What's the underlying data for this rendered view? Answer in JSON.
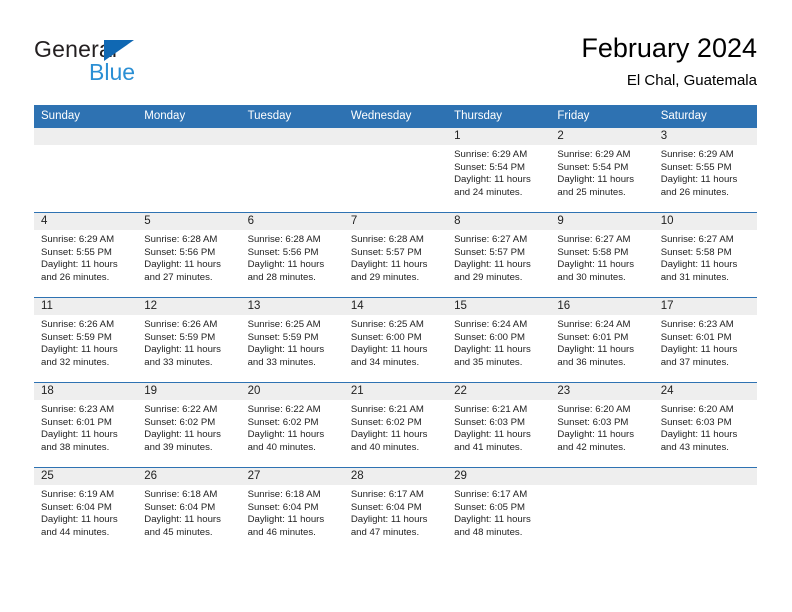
{
  "brand": {
    "name_part1": "General",
    "name_part2": "Blue",
    "triangle_icon": "blue-triangle-icon",
    "accent_blue": "#2e72b2",
    "logo_blue": "#2b8fd4"
  },
  "header": {
    "title": "February 2024",
    "subtitle": "El Chal, Guatemala"
  },
  "weekday_headers": [
    "Sunday",
    "Monday",
    "Tuesday",
    "Wednesday",
    "Thursday",
    "Friday",
    "Saturday"
  ],
  "labels": {
    "sunrise_prefix": "Sunrise:",
    "sunset_prefix": "Sunset:",
    "daylight_prefix": "Daylight:"
  },
  "weeks": [
    [
      {
        "day": "",
        "sunrise": "",
        "sunset": "",
        "daylight": "",
        "empty": true
      },
      {
        "day": "",
        "sunrise": "",
        "sunset": "",
        "daylight": "",
        "empty": true
      },
      {
        "day": "",
        "sunrise": "",
        "sunset": "",
        "daylight": "",
        "empty": true
      },
      {
        "day": "",
        "sunrise": "",
        "sunset": "",
        "daylight": "",
        "empty": true
      },
      {
        "day": "1",
        "sunrise": "Sunrise: 6:29 AM",
        "sunset": "Sunset: 5:54 PM",
        "daylight": "Daylight: 11 hours and 24 minutes.",
        "empty": false
      },
      {
        "day": "2",
        "sunrise": "Sunrise: 6:29 AM",
        "sunset": "Sunset: 5:54 PM",
        "daylight": "Daylight: 11 hours and 25 minutes.",
        "empty": false
      },
      {
        "day": "3",
        "sunrise": "Sunrise: 6:29 AM",
        "sunset": "Sunset: 5:55 PM",
        "daylight": "Daylight: 11 hours and 26 minutes.",
        "empty": false
      }
    ],
    [
      {
        "day": "4",
        "sunrise": "Sunrise: 6:29 AM",
        "sunset": "Sunset: 5:55 PM",
        "daylight": "Daylight: 11 hours and 26 minutes.",
        "empty": false
      },
      {
        "day": "5",
        "sunrise": "Sunrise: 6:28 AM",
        "sunset": "Sunset: 5:56 PM",
        "daylight": "Daylight: 11 hours and 27 minutes.",
        "empty": false
      },
      {
        "day": "6",
        "sunrise": "Sunrise: 6:28 AM",
        "sunset": "Sunset: 5:56 PM",
        "daylight": "Daylight: 11 hours and 28 minutes.",
        "empty": false
      },
      {
        "day": "7",
        "sunrise": "Sunrise: 6:28 AM",
        "sunset": "Sunset: 5:57 PM",
        "daylight": "Daylight: 11 hours and 29 minutes.",
        "empty": false
      },
      {
        "day": "8",
        "sunrise": "Sunrise: 6:27 AM",
        "sunset": "Sunset: 5:57 PM",
        "daylight": "Daylight: 11 hours and 29 minutes.",
        "empty": false
      },
      {
        "day": "9",
        "sunrise": "Sunrise: 6:27 AM",
        "sunset": "Sunset: 5:58 PM",
        "daylight": "Daylight: 11 hours and 30 minutes.",
        "empty": false
      },
      {
        "day": "10",
        "sunrise": "Sunrise: 6:27 AM",
        "sunset": "Sunset: 5:58 PM",
        "daylight": "Daylight: 11 hours and 31 minutes.",
        "empty": false
      }
    ],
    [
      {
        "day": "11",
        "sunrise": "Sunrise: 6:26 AM",
        "sunset": "Sunset: 5:59 PM",
        "daylight": "Daylight: 11 hours and 32 minutes.",
        "empty": false
      },
      {
        "day": "12",
        "sunrise": "Sunrise: 6:26 AM",
        "sunset": "Sunset: 5:59 PM",
        "daylight": "Daylight: 11 hours and 33 minutes.",
        "empty": false
      },
      {
        "day": "13",
        "sunrise": "Sunrise: 6:25 AM",
        "sunset": "Sunset: 5:59 PM",
        "daylight": "Daylight: 11 hours and 33 minutes.",
        "empty": false
      },
      {
        "day": "14",
        "sunrise": "Sunrise: 6:25 AM",
        "sunset": "Sunset: 6:00 PM",
        "daylight": "Daylight: 11 hours and 34 minutes.",
        "empty": false
      },
      {
        "day": "15",
        "sunrise": "Sunrise: 6:24 AM",
        "sunset": "Sunset: 6:00 PM",
        "daylight": "Daylight: 11 hours and 35 minutes.",
        "empty": false
      },
      {
        "day": "16",
        "sunrise": "Sunrise: 6:24 AM",
        "sunset": "Sunset: 6:01 PM",
        "daylight": "Daylight: 11 hours and 36 minutes.",
        "empty": false
      },
      {
        "day": "17",
        "sunrise": "Sunrise: 6:23 AM",
        "sunset": "Sunset: 6:01 PM",
        "daylight": "Daylight: 11 hours and 37 minutes.",
        "empty": false
      }
    ],
    [
      {
        "day": "18",
        "sunrise": "Sunrise: 6:23 AM",
        "sunset": "Sunset: 6:01 PM",
        "daylight": "Daylight: 11 hours and 38 minutes.",
        "empty": false
      },
      {
        "day": "19",
        "sunrise": "Sunrise: 6:22 AM",
        "sunset": "Sunset: 6:02 PM",
        "daylight": "Daylight: 11 hours and 39 minutes.",
        "empty": false
      },
      {
        "day": "20",
        "sunrise": "Sunrise: 6:22 AM",
        "sunset": "Sunset: 6:02 PM",
        "daylight": "Daylight: 11 hours and 40 minutes.",
        "empty": false
      },
      {
        "day": "21",
        "sunrise": "Sunrise: 6:21 AM",
        "sunset": "Sunset: 6:02 PM",
        "daylight": "Daylight: 11 hours and 40 minutes.",
        "empty": false
      },
      {
        "day": "22",
        "sunrise": "Sunrise: 6:21 AM",
        "sunset": "Sunset: 6:03 PM",
        "daylight": "Daylight: 11 hours and 41 minutes.",
        "empty": false
      },
      {
        "day": "23",
        "sunrise": "Sunrise: 6:20 AM",
        "sunset": "Sunset: 6:03 PM",
        "daylight": "Daylight: 11 hours and 42 minutes.",
        "empty": false
      },
      {
        "day": "24",
        "sunrise": "Sunrise: 6:20 AM",
        "sunset": "Sunset: 6:03 PM",
        "daylight": "Daylight: 11 hours and 43 minutes.",
        "empty": false
      }
    ],
    [
      {
        "day": "25",
        "sunrise": "Sunrise: 6:19 AM",
        "sunset": "Sunset: 6:04 PM",
        "daylight": "Daylight: 11 hours and 44 minutes.",
        "empty": false
      },
      {
        "day": "26",
        "sunrise": "Sunrise: 6:18 AM",
        "sunset": "Sunset: 6:04 PM",
        "daylight": "Daylight: 11 hours and 45 minutes.",
        "empty": false
      },
      {
        "day": "27",
        "sunrise": "Sunrise: 6:18 AM",
        "sunset": "Sunset: 6:04 PM",
        "daylight": "Daylight: 11 hours and 46 minutes.",
        "empty": false
      },
      {
        "day": "28",
        "sunrise": "Sunrise: 6:17 AM",
        "sunset": "Sunset: 6:04 PM",
        "daylight": "Daylight: 11 hours and 47 minutes.",
        "empty": false
      },
      {
        "day": "29",
        "sunrise": "Sunrise: 6:17 AM",
        "sunset": "Sunset: 6:05 PM",
        "daylight": "Daylight: 11 hours and 48 minutes.",
        "empty": false
      },
      {
        "day": "",
        "sunrise": "",
        "sunset": "",
        "daylight": "",
        "empty": true
      },
      {
        "day": "",
        "sunrise": "",
        "sunset": "",
        "daylight": "",
        "empty": true
      }
    ]
  ]
}
